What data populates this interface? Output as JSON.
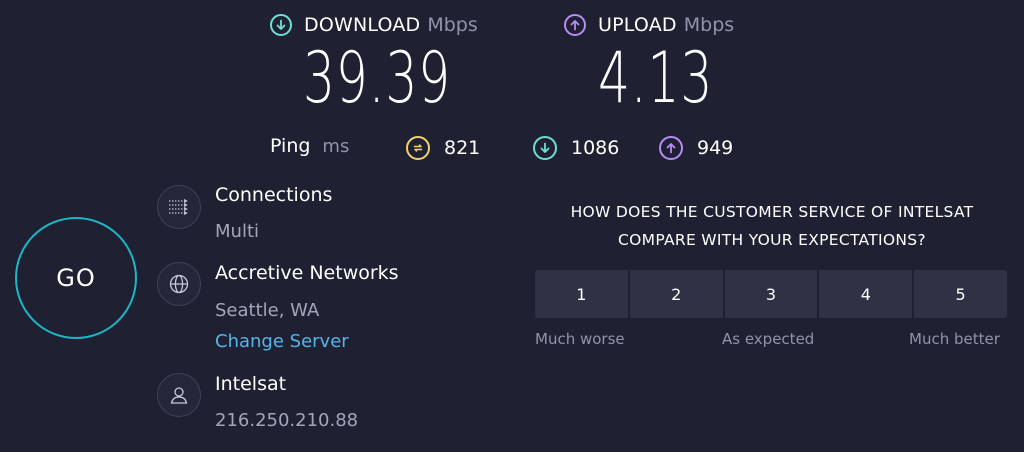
{
  "download": {
    "label": "DOWNLOAD",
    "unit": "Mbps",
    "value": "39.39",
    "icon": "arrow-down-circle-icon",
    "color": "#6ee0d3"
  },
  "upload": {
    "label": "UPLOAD",
    "unit": "Mbps",
    "value": "4.13",
    "icon": "arrow-up-circle-icon",
    "color": "#b98bf5"
  },
  "ping": {
    "label": "Ping",
    "unit": "ms",
    "items": [
      {
        "icon": "jitter-icon",
        "value": "821",
        "color": "#f0d36a"
      },
      {
        "icon": "arrow-down-icon",
        "value": "1086",
        "color": "#6ee0d3"
      },
      {
        "icon": "arrow-up-icon",
        "value": "949",
        "color": "#b98bf5"
      }
    ]
  },
  "go": {
    "label": "GO",
    "ring_color": "#1bb7c7"
  },
  "connections": {
    "title": "Connections",
    "value": "Multi"
  },
  "server": {
    "title": "Accretive Networks",
    "location": "Seattle, WA",
    "change_label": "Change Server"
  },
  "isp": {
    "title": "Intelsat",
    "ip": "216.250.210.88"
  },
  "survey": {
    "question_line1": "HOW DOES THE CUSTOMER SERVICE OF INTELSAT",
    "question_line2": "COMPARE WITH YOUR EXPECTATIONS?",
    "ratings": [
      "1",
      "2",
      "3",
      "4",
      "5"
    ],
    "caption_low": "Much worse",
    "caption_mid": "As expected",
    "caption_high": "Much better"
  }
}
